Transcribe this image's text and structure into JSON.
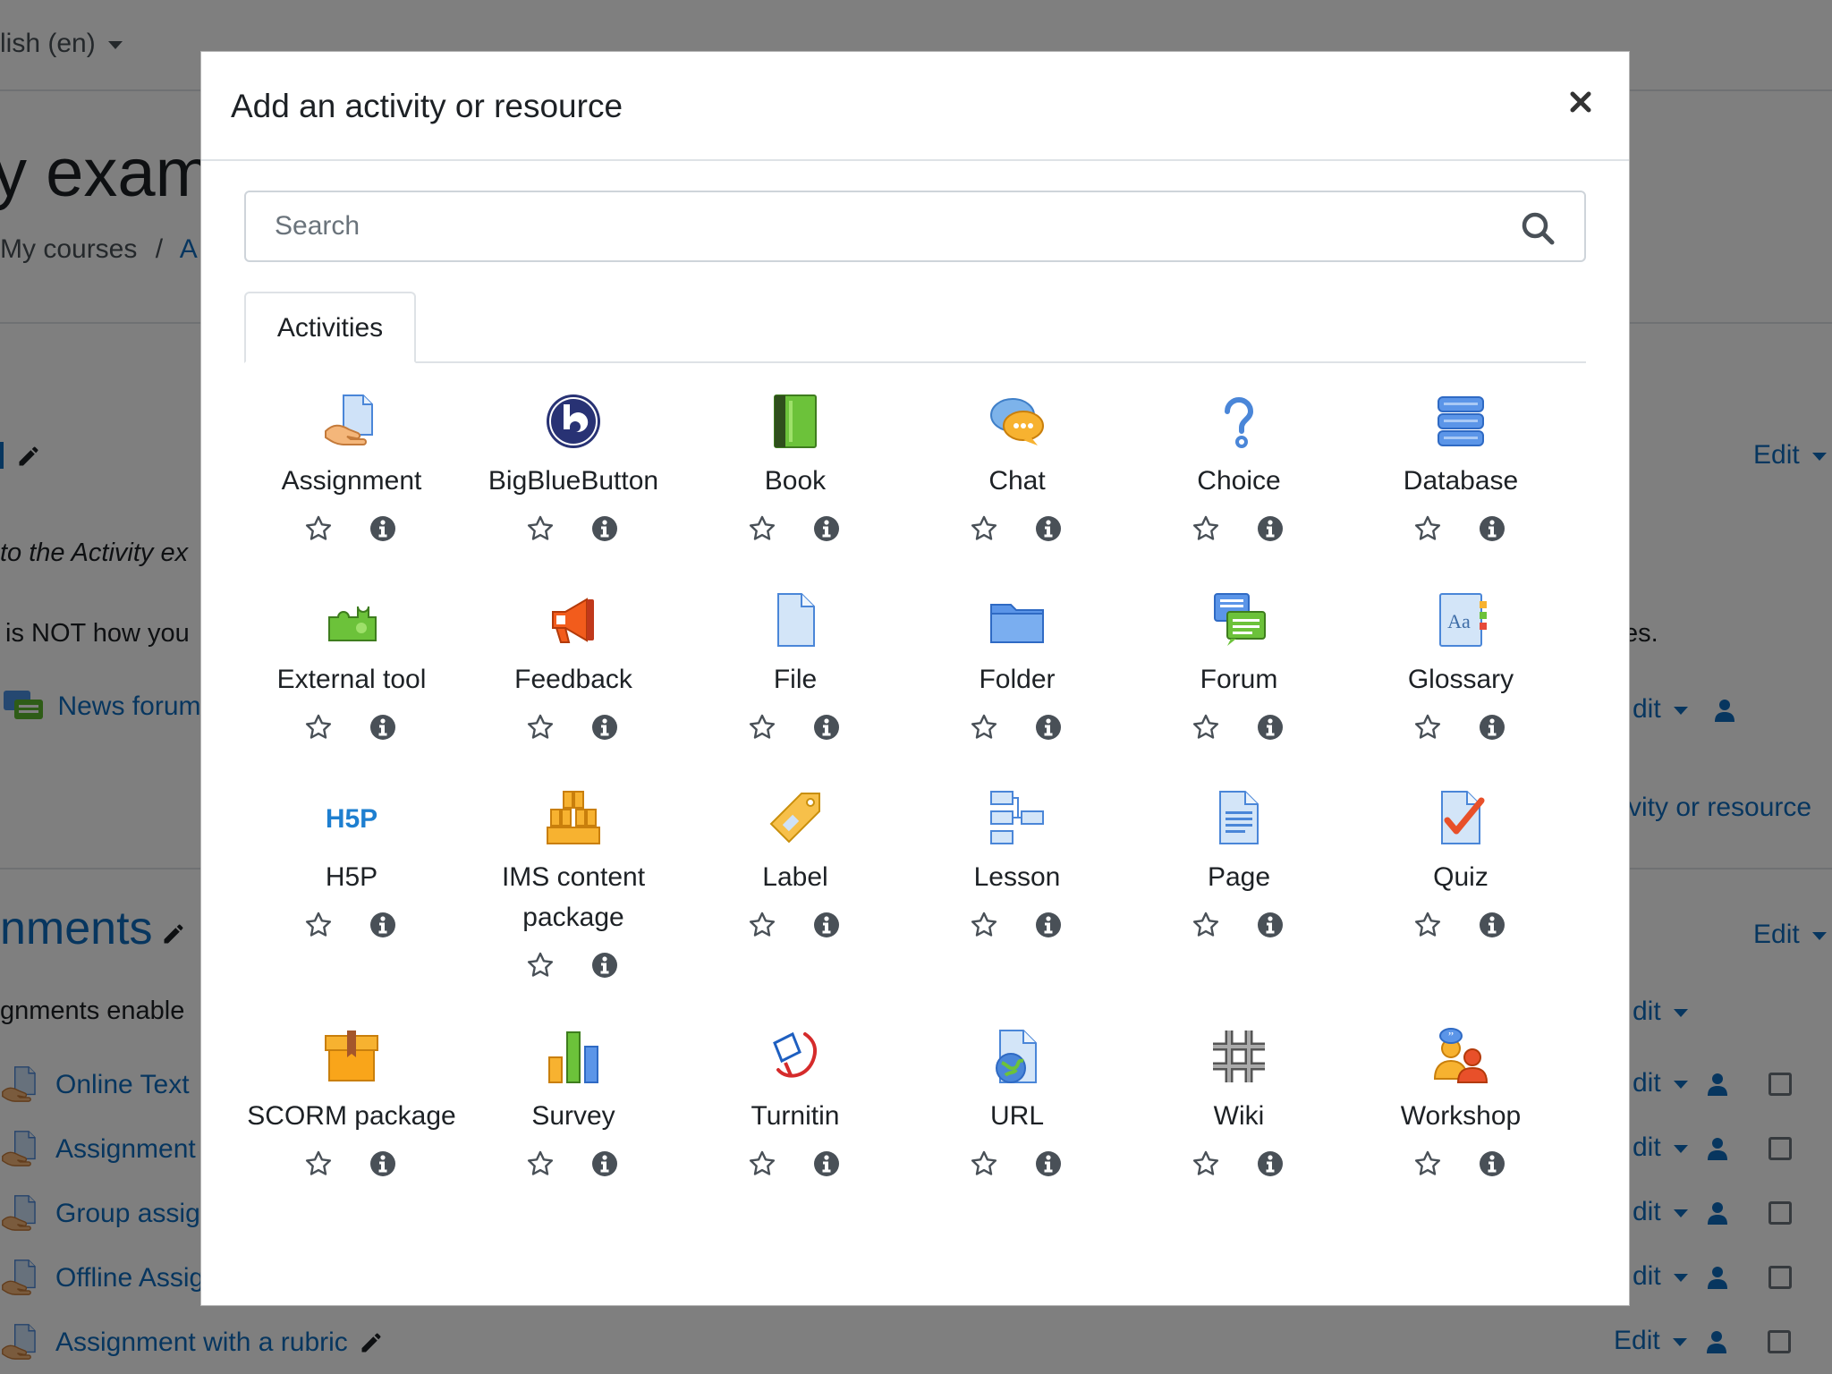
{
  "background": {
    "language": "lish (en)",
    "course_title": "y exam",
    "breadcrumb": {
      "my_courses": "My courses",
      "separator": "/",
      "next": "A"
    },
    "intro_italic": "to the Activity ex",
    "intro_text": "is NOT how you",
    "news_forum": "News forum",
    "right_fragment_1": "es.",
    "right_fragment_2": "vity or resource",
    "section_title": "nments",
    "section_desc": "gnments enable",
    "edit_label": "Edit",
    "edit_fragment": "dit",
    "activities": [
      "Online Text",
      "Assignment",
      "Group assig",
      "Offline Assig",
      "Assignment with a rubric"
    ]
  },
  "modal": {
    "title": "Add an activity or resource",
    "search": {
      "placeholder": "Search",
      "value": ""
    },
    "tabs": [
      {
        "label": "Activities",
        "active": true
      }
    ],
    "items": [
      {
        "label": "Assignment",
        "icon": "assignment-icon"
      },
      {
        "label": "BigBlueButton",
        "icon": "bigbluebutton-icon"
      },
      {
        "label": "Book",
        "icon": "book-icon"
      },
      {
        "label": "Chat",
        "icon": "chat-icon"
      },
      {
        "label": "Choice",
        "icon": "choice-icon"
      },
      {
        "label": "Database",
        "icon": "database-icon"
      },
      {
        "label": "External tool",
        "icon": "external-tool-icon"
      },
      {
        "label": "Feedback",
        "icon": "feedback-icon"
      },
      {
        "label": "File",
        "icon": "file-icon"
      },
      {
        "label": "Folder",
        "icon": "folder-icon"
      },
      {
        "label": "Forum",
        "icon": "forum-icon"
      },
      {
        "label": "Glossary",
        "icon": "glossary-icon"
      },
      {
        "label": "H5P",
        "icon": "h5p-icon"
      },
      {
        "label": "IMS content package",
        "icon": "ims-package-icon"
      },
      {
        "label": "Label",
        "icon": "label-icon"
      },
      {
        "label": "Lesson",
        "icon": "lesson-icon"
      },
      {
        "label": "Page",
        "icon": "page-icon"
      },
      {
        "label": "Quiz",
        "icon": "quiz-icon"
      },
      {
        "label": "SCORM package",
        "icon": "scorm-icon"
      },
      {
        "label": "Survey",
        "icon": "survey-icon"
      },
      {
        "label": "Turnitin",
        "icon": "turnitin-icon"
      },
      {
        "label": "URL",
        "icon": "url-icon"
      },
      {
        "label": "Wiki",
        "icon": "wiki-icon"
      },
      {
        "label": "Workshop",
        "icon": "workshop-icon"
      }
    ]
  },
  "colors": {
    "link": "#0f6cbf",
    "text": "#1d2125",
    "border": "#dee2e6",
    "icon_grey": "#495057",
    "overlay": "rgba(0,0,0,0.5)"
  }
}
